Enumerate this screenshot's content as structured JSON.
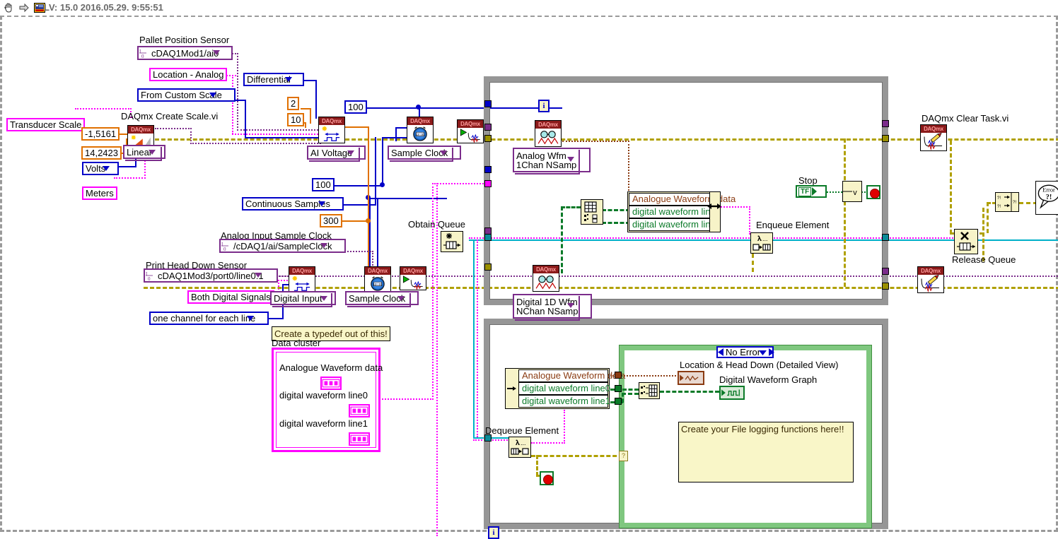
{
  "window": {
    "title": "LV: 15.0 2016.05.29. 9:55:51",
    "icons": [
      "hand-tool-icon",
      "run-arrow-icon",
      "vi-icon"
    ]
  },
  "labels": {
    "pallet_position_sensor": "Pallet Position Sensor",
    "daqmx_create_scale": "DAQmx Create Scale.vi",
    "analog_input_sample_clock": "Analog Input Sample Clock",
    "print_head_down_sensor": "Print Head Down Sensor",
    "data_cluster": "Data cluster",
    "obtain_queue": "Obtain Queue",
    "enqueue_element": "Enqueue Element",
    "dequeue_element": "Dequeue Element",
    "release_queue": "Release Queue",
    "daqmx_clear_task": "DAQmx Clear Task.vi",
    "stop": "Stop",
    "location_head_down": "Location & Head Down (Detailed View)",
    "digital_waveform_graph": "Digital Waveform Graph"
  },
  "controls": {
    "pallet_channel": "cDAQ1Mod1/ai0",
    "sample_clock_source": "/cDAQ1/ai/SampleClock",
    "print_head_channel": "cDAQ1Mod3/port0/line0:1",
    "terminal_config": "Differential",
    "units_mode": "From Custom Scale",
    "ai_voltage": "AI Voltage",
    "sample_clock_a": "Sample Clock",
    "sample_clock_b": "Sample Clock",
    "digital_input": "Digital Input",
    "line_grouping": "one channel for each line",
    "sample_mode": "Continuous Samples",
    "scale_type": "Linear",
    "pre_scaled_units": "Volts",
    "analog_read_mode": "Analog Wfm\n1Chan NSamp",
    "analog_read_mode_line1": "Analog Wfm",
    "analog_read_mode_line2": "1Chan NSamp",
    "digital_read_mode_line1": "Digital 1D Wfm",
    "digital_read_mode_line2": "NChan NSamp",
    "case_selector": "No Error"
  },
  "constants": {
    "scale_slope": "-1,5161",
    "scale_intercept": "14,2423",
    "scaled_units": "Meters",
    "scale_name": "Transducer Scale",
    "task_name_analog": "Location - Analog",
    "task_name_digital": "Both Digital Signals",
    "min_value": "2",
    "max_value": "10",
    "rate_top": "100",
    "samples_per_channel": "100",
    "rate_bottom": "100",
    "queue_size": "300"
  },
  "cluster": {
    "title": "Analogue Waveform data",
    "line0": "digital waveform line0",
    "line1": "digital waveform line1"
  },
  "comments": {
    "typedef": "Create a typedef out of this!",
    "file_logging": "Create your File logging functions here!!"
  },
  "iteration_terminals": [
    "i",
    "i"
  ],
  "colors": {
    "daqmx_purple": "#7b2d8b",
    "numeric_blue": "#0000c8",
    "numeric_orange": "#e07000",
    "string_magenta": "#ff00ff",
    "error_yellow": "#b0a000",
    "loop_gray": "#969696",
    "case_green": "#7fc77f",
    "node_yellow": "#f7f3c8",
    "boolean_green": "#0a7a28",
    "waveform_brown": "#8a3b12",
    "digital_green": "#0a7a28"
  }
}
